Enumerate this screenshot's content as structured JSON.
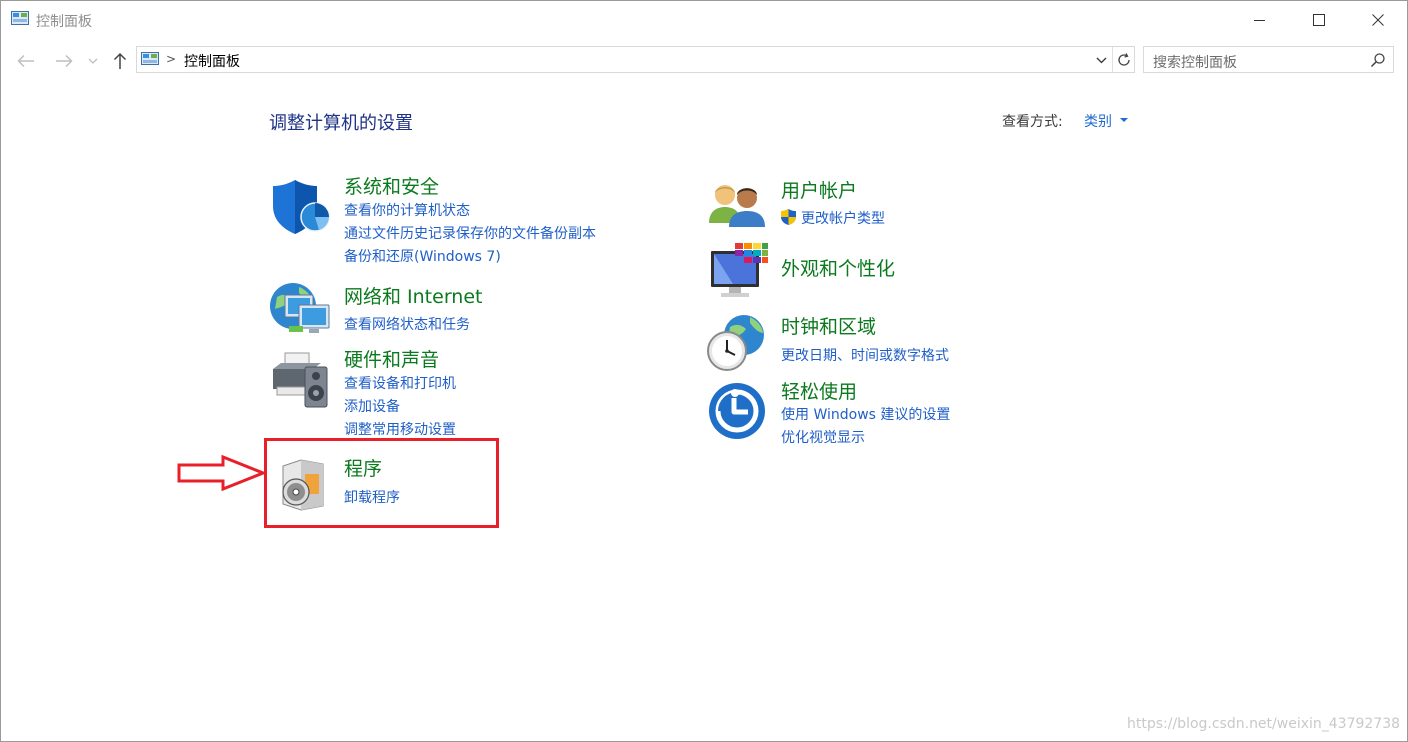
{
  "window": {
    "title": "控制面板",
    "controls": {
      "minimize": "minimize-icon",
      "maximize": "maximize-icon",
      "close": "close-icon"
    }
  },
  "nav": {
    "breadcrumb": [
      "控制面板"
    ],
    "search_placeholder": "搜索控制面板"
  },
  "content": {
    "heading": "调整计算机的设置",
    "view_by": {
      "label": "查看方式:",
      "value": "类别"
    }
  },
  "categories": {
    "system_security": {
      "title": "系统和安全",
      "icon": "shield-icon",
      "links": [
        "查看你的计算机状态",
        "通过文件历史记录保存你的文件备份副本",
        "备份和还原(Windows 7)"
      ]
    },
    "network": {
      "title": "网络和 Internet",
      "icon": "network-globe-icon",
      "links": [
        "查看网络状态和任务"
      ]
    },
    "hardware_sound": {
      "title": "硬件和声音",
      "icon": "printer-speaker-icon",
      "links": [
        "查看设备和打印机",
        "添加设备",
        "调整常用移动设置"
      ]
    },
    "programs": {
      "title": "程序",
      "icon": "programs-disc-icon",
      "links": [
        "卸载程序"
      ]
    },
    "user_accounts": {
      "title": "用户帐户",
      "icon": "users-icon",
      "links": [
        "更改帐户类型"
      ],
      "link_icon": "uac-shield-icon"
    },
    "appearance": {
      "title": "外观和个性化",
      "icon": "monitor-palette-icon",
      "links": []
    },
    "clock_region": {
      "title": "时钟和区域",
      "icon": "clock-globe-icon",
      "links": [
        "更改日期、时间或数字格式"
      ]
    },
    "ease_of_access": {
      "title": "轻松使用",
      "icon": "ease-of-access-icon",
      "links": [
        "使用 Windows 建议的设置",
        "优化视觉显示"
      ]
    }
  },
  "annotation": {
    "highlight_color": "#e8202a",
    "arrow_color": "#e8202a"
  },
  "watermark": "https://blog.csdn.net/weixin_43792738",
  "colors": {
    "link": "#1f5fc8",
    "category_title": "#0b7a1e",
    "heading": "#1e3287"
  }
}
